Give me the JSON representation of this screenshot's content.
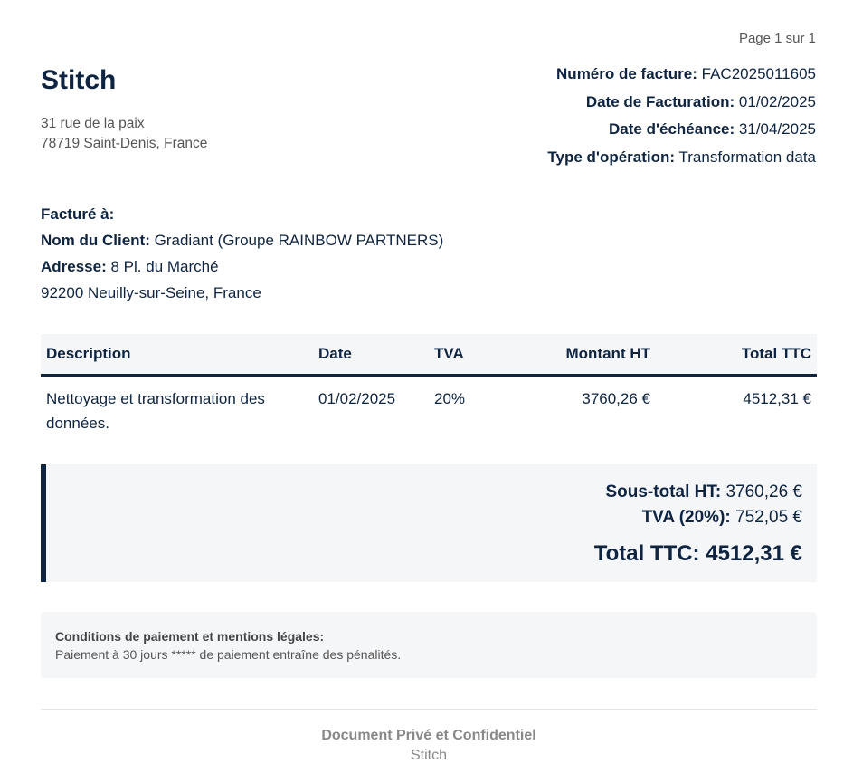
{
  "page": {
    "number_label": "Page 1 sur 1"
  },
  "company": {
    "name": "Stitch",
    "address_line1": "31 rue de la paix",
    "address_line2": "78719 Saint-Denis, France"
  },
  "invoice": {
    "number_label": "Numéro de facture:",
    "number_value": "FAC2025011605",
    "date_label": "Date de Facturation:",
    "date_value": "01/02/2025",
    "due_label": "Date d'échéance:",
    "due_value": "31/04/2025",
    "operation_label": "Type d'opération:",
    "operation_value": "Transformation data"
  },
  "bill_to": {
    "heading": "Facturé à:",
    "client_label": "Nom du Client:",
    "client_value": "Gradiant (Groupe RAINBOW PARTNERS)",
    "address_label": "Adresse:",
    "address_value": "8 Pl. du Marché",
    "address_line2": "92200 Neuilly-sur-Seine, France"
  },
  "table": {
    "headers": [
      "Description",
      "Date",
      "TVA",
      "Montant HT",
      "Total TTC"
    ],
    "rows": [
      [
        "Nettoyage et transformation des données.",
        "01/02/2025",
        "20%",
        "3760,26 €",
        "4512,31 €"
      ]
    ]
  },
  "totals": {
    "subtotal_label": "Sous-total HT:",
    "subtotal_value": "3760,26 €",
    "tva_label": "TVA (20%):",
    "tva_value": "752,05 €",
    "total_label": "Total TTC:",
    "total_value": "4512,31 €"
  },
  "conditions": {
    "title": "Conditions de paiement et mentions légales:",
    "text": "Paiement à 30 jours ***** de paiement entraîne des pénalités."
  },
  "footer": {
    "title": "Document Privé et Confidentiel",
    "subtitle": "Stitch"
  },
  "colors": {
    "primary": "#0f2440",
    "panel_background": "#f5f6f8",
    "muted_text": "#555555"
  }
}
